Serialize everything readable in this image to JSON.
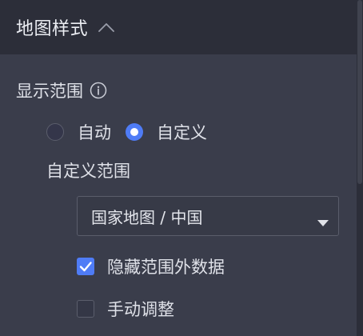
{
  "section": {
    "title": "地图样式",
    "expanded": true
  },
  "display_range": {
    "label": "显示范围",
    "info_icon": "info-circle-icon",
    "options": [
      {
        "label": "自动",
        "selected": false
      },
      {
        "label": "自定义",
        "selected": true
      }
    ]
  },
  "custom_range": {
    "label": "自定义范围",
    "select_value": "国家地图 / 中国"
  },
  "checkboxes": [
    {
      "label": "隐藏范围外数据",
      "checked": true
    },
    {
      "label": "手动调整",
      "checked": false
    }
  ],
  "colors": {
    "accent": "#4f7cf6",
    "panel_bg": "#3a3d4b",
    "header_bg": "#2c2e39"
  }
}
